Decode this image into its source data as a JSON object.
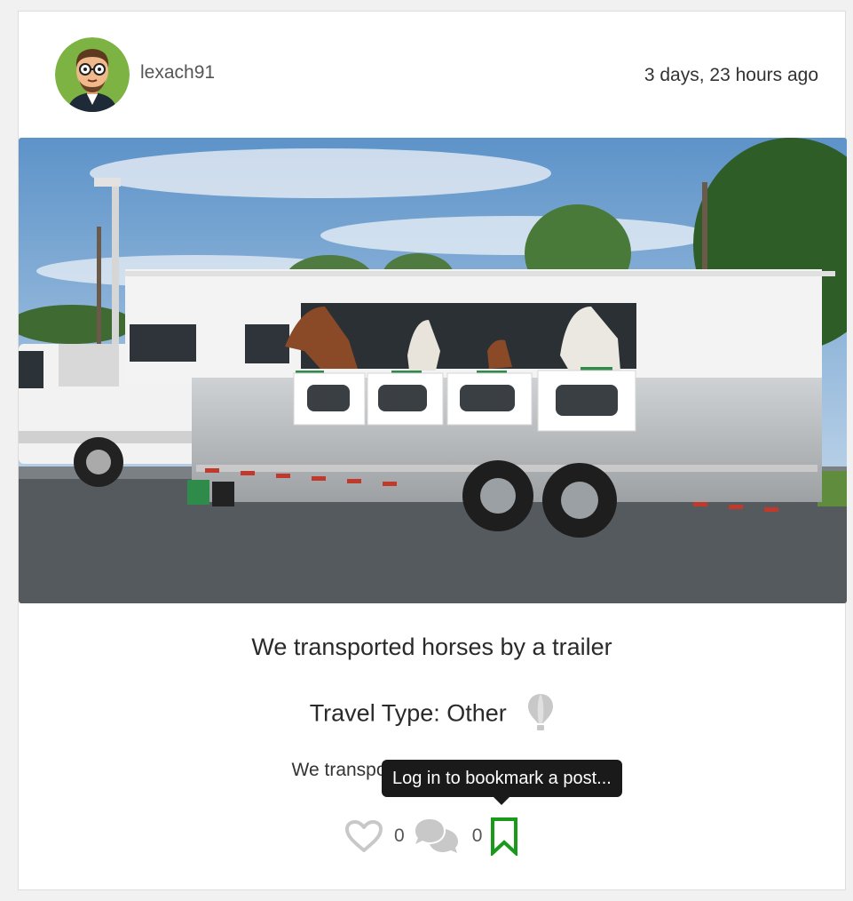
{
  "post": {
    "username": "lexach91",
    "timestamp": "3 days, 23 hours ago",
    "title": "We transported horses by a trailer",
    "travel_type": "Travel Type: Other",
    "body": "We transported horses by a trailer",
    "likes": "0",
    "comments": "0"
  },
  "tooltip": {
    "text": "Log in to bookmark a post..."
  },
  "icons": {
    "avatar": "avatar-icon",
    "travel_type": "hot-air-balloon-icon",
    "like": "heart-icon",
    "comment": "comments-icon",
    "bookmark": "bookmark-icon"
  },
  "colors": {
    "bookmark": "#1a9a1a",
    "icon_gray": "#c8c8c8",
    "tooltip_bg": "#1a1a1a"
  }
}
